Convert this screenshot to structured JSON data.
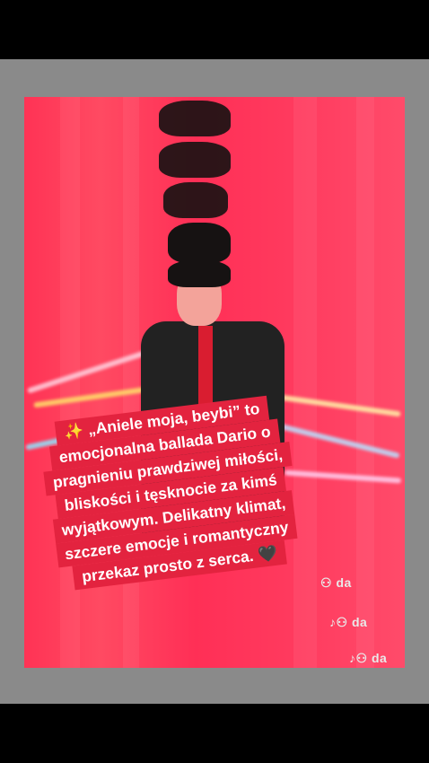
{
  "caption": {
    "lines": [
      "✨ „Aniele moja, beybi” to",
      "emocjonalna ballada Dario o",
      "pragnieniu prawdziwej miłości,",
      "bliskości i tęsknocie za kimś",
      "wyjątkowym. Delikatny klimat,",
      "szczere emocje i romantyczny",
      "przekaz prosto z serca. 🖤"
    ]
  },
  "watermarks": [
    {
      "icon": "tiktok-logo",
      "user_icon": "user-icon",
      "text": "da"
    },
    {
      "icon": "tiktok-logo",
      "user_icon": "user-icon",
      "text": "da"
    },
    {
      "icon": "tiktok-logo",
      "user_icon": "user-icon",
      "text": "da"
    }
  ],
  "colors": {
    "background": "#000000",
    "frame": "#8a8a8a",
    "video": "#ff3355",
    "caption_bg": "#e3233f",
    "caption_text": "#ffffff"
  }
}
